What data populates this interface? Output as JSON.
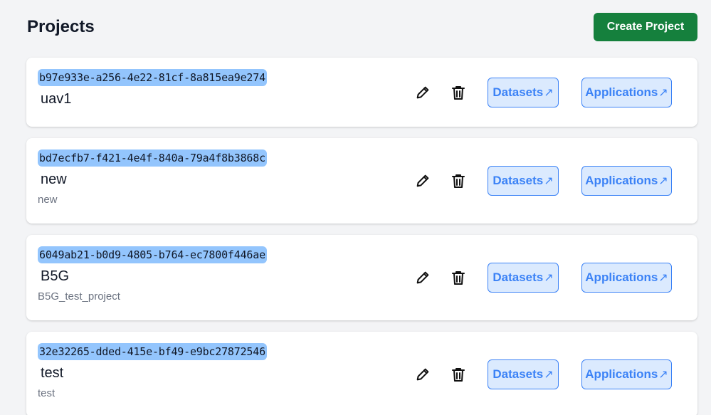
{
  "header": {
    "title": "Projects",
    "create_label": "Create Project"
  },
  "colors": {
    "primary_green": "#15803d",
    "accent_blue": "#3b82f6",
    "id_highlight": "#93c5fd",
    "link_bg": "#dbeafe"
  },
  "icons": {
    "edit": "pencil-icon",
    "delete": "trash-icon",
    "external": "arrow-up-right-icon"
  },
  "projects": [
    {
      "id": "b97e933e-a256-4e22-81cf-8a815ea9e274",
      "name": "uav1",
      "description": "",
      "datasets_label": "Datasets",
      "applications_label": "Applications",
      "arrow": "↗"
    },
    {
      "id": "bd7ecfb7-f421-4e4f-840a-79a4f8b3868c",
      "name": "new",
      "description": "new",
      "datasets_label": "Datasets",
      "applications_label": "Applications",
      "arrow": "↗"
    },
    {
      "id": "6049ab21-b0d9-4805-b764-ec7800f446ae",
      "name": "B5G",
      "description": "B5G_test_project",
      "datasets_label": "Datasets",
      "applications_label": "Applications",
      "arrow": "↗"
    },
    {
      "id": "32e32265-dded-415e-bf49-e9bc27872546",
      "name": "test",
      "description": "test",
      "datasets_label": "Datasets",
      "applications_label": "Applications",
      "arrow": "↗"
    }
  ]
}
